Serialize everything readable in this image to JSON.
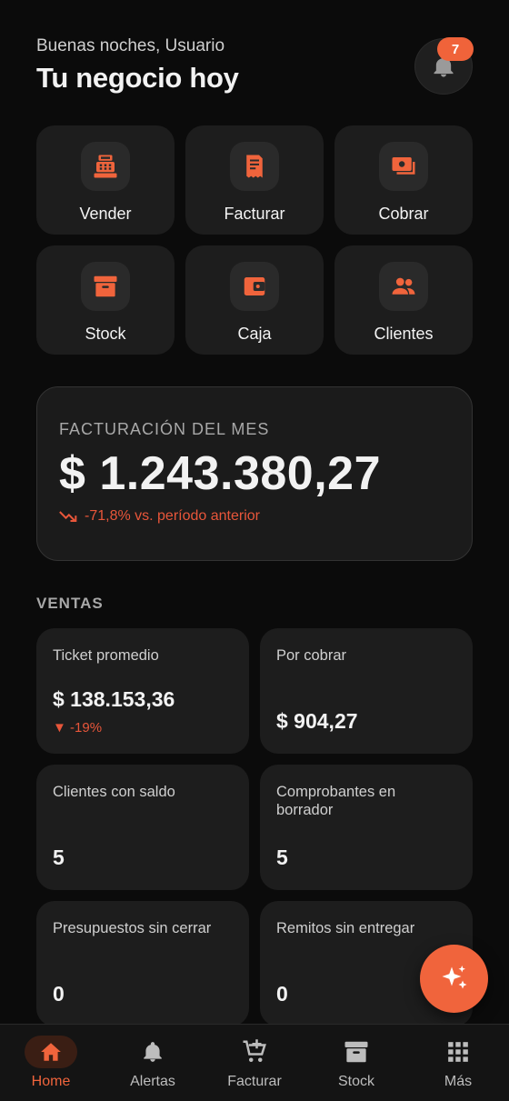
{
  "header": {
    "greeting": "Buenas noches, Usuario",
    "title": "Tu negocio hoy",
    "notifications_count": "7"
  },
  "actions": [
    {
      "label": "Vender",
      "icon": "cash-register-icon"
    },
    {
      "label": "Facturar",
      "icon": "invoice-icon"
    },
    {
      "label": "Cobrar",
      "icon": "payments-icon"
    },
    {
      "label": "Stock",
      "icon": "archive-box-icon"
    },
    {
      "label": "Caja",
      "icon": "wallet-icon"
    },
    {
      "label": "Clientes",
      "icon": "people-icon"
    }
  ],
  "month": {
    "label": "FACTURACIÓN DEL MES",
    "amount": "$ 1.243.380,27",
    "change": "-71,8% vs. período anterior"
  },
  "sales": {
    "title": "VENTAS",
    "stats": [
      {
        "label": "Ticket promedio",
        "value": "$ 138.153,36",
        "change": "▼ -19%"
      },
      {
        "label": "Por cobrar",
        "value": "$ 904,27"
      },
      {
        "label": "Clientes con saldo",
        "value": "5"
      },
      {
        "label": "Comprobantes en borrador",
        "value": "5"
      },
      {
        "label": "Presupuestos sin cerrar",
        "value": "0"
      },
      {
        "label": "Remitos sin entregar",
        "value": "0"
      }
    ]
  },
  "nav": [
    {
      "label": "Home",
      "icon": "home-icon",
      "active": true
    },
    {
      "label": "Alertas",
      "icon": "bell-icon"
    },
    {
      "label": "Facturar",
      "icon": "cart-add-icon"
    },
    {
      "label": "Stock",
      "icon": "archive-box-icon"
    },
    {
      "label": "Más",
      "icon": "apps-grid-icon"
    }
  ],
  "colors": {
    "accent": "#f0643c",
    "negative": "#e8563a",
    "background": "#0b0b0b",
    "card": "#1d1d1d"
  }
}
